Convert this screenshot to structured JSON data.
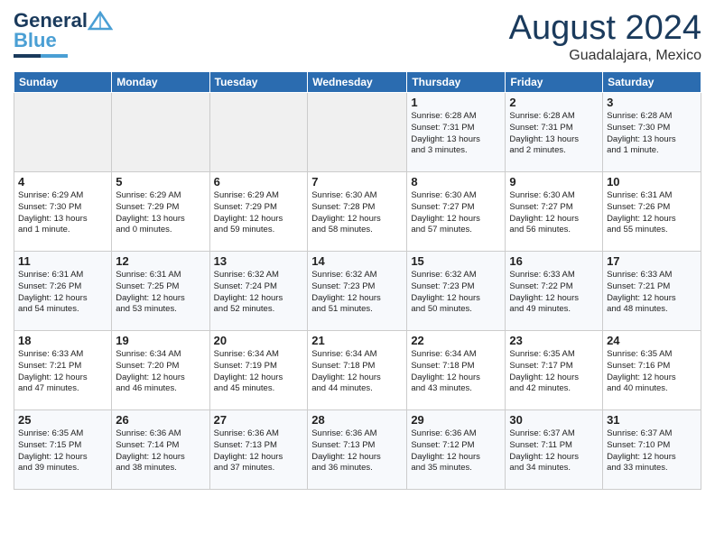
{
  "header": {
    "logo_line1": "General",
    "logo_line2": "Blue",
    "month": "August 2024",
    "location": "Guadalajara, Mexico"
  },
  "days_of_week": [
    "Sunday",
    "Monday",
    "Tuesday",
    "Wednesday",
    "Thursday",
    "Friday",
    "Saturday"
  ],
  "weeks": [
    [
      {
        "num": "",
        "info": ""
      },
      {
        "num": "",
        "info": ""
      },
      {
        "num": "",
        "info": ""
      },
      {
        "num": "",
        "info": ""
      },
      {
        "num": "1",
        "info": "Sunrise: 6:28 AM\nSunset: 7:31 PM\nDaylight: 13 hours\nand 3 minutes."
      },
      {
        "num": "2",
        "info": "Sunrise: 6:28 AM\nSunset: 7:31 PM\nDaylight: 13 hours\nand 2 minutes."
      },
      {
        "num": "3",
        "info": "Sunrise: 6:28 AM\nSunset: 7:30 PM\nDaylight: 13 hours\nand 1 minute."
      }
    ],
    [
      {
        "num": "4",
        "info": "Sunrise: 6:29 AM\nSunset: 7:30 PM\nDaylight: 13 hours\nand 1 minute."
      },
      {
        "num": "5",
        "info": "Sunrise: 6:29 AM\nSunset: 7:29 PM\nDaylight: 13 hours\nand 0 minutes."
      },
      {
        "num": "6",
        "info": "Sunrise: 6:29 AM\nSunset: 7:29 PM\nDaylight: 12 hours\nand 59 minutes."
      },
      {
        "num": "7",
        "info": "Sunrise: 6:30 AM\nSunset: 7:28 PM\nDaylight: 12 hours\nand 58 minutes."
      },
      {
        "num": "8",
        "info": "Sunrise: 6:30 AM\nSunset: 7:27 PM\nDaylight: 12 hours\nand 57 minutes."
      },
      {
        "num": "9",
        "info": "Sunrise: 6:30 AM\nSunset: 7:27 PM\nDaylight: 12 hours\nand 56 minutes."
      },
      {
        "num": "10",
        "info": "Sunrise: 6:31 AM\nSunset: 7:26 PM\nDaylight: 12 hours\nand 55 minutes."
      }
    ],
    [
      {
        "num": "11",
        "info": "Sunrise: 6:31 AM\nSunset: 7:26 PM\nDaylight: 12 hours\nand 54 minutes."
      },
      {
        "num": "12",
        "info": "Sunrise: 6:31 AM\nSunset: 7:25 PM\nDaylight: 12 hours\nand 53 minutes."
      },
      {
        "num": "13",
        "info": "Sunrise: 6:32 AM\nSunset: 7:24 PM\nDaylight: 12 hours\nand 52 minutes."
      },
      {
        "num": "14",
        "info": "Sunrise: 6:32 AM\nSunset: 7:23 PM\nDaylight: 12 hours\nand 51 minutes."
      },
      {
        "num": "15",
        "info": "Sunrise: 6:32 AM\nSunset: 7:23 PM\nDaylight: 12 hours\nand 50 minutes."
      },
      {
        "num": "16",
        "info": "Sunrise: 6:33 AM\nSunset: 7:22 PM\nDaylight: 12 hours\nand 49 minutes."
      },
      {
        "num": "17",
        "info": "Sunrise: 6:33 AM\nSunset: 7:21 PM\nDaylight: 12 hours\nand 48 minutes."
      }
    ],
    [
      {
        "num": "18",
        "info": "Sunrise: 6:33 AM\nSunset: 7:21 PM\nDaylight: 12 hours\nand 47 minutes."
      },
      {
        "num": "19",
        "info": "Sunrise: 6:34 AM\nSunset: 7:20 PM\nDaylight: 12 hours\nand 46 minutes."
      },
      {
        "num": "20",
        "info": "Sunrise: 6:34 AM\nSunset: 7:19 PM\nDaylight: 12 hours\nand 45 minutes."
      },
      {
        "num": "21",
        "info": "Sunrise: 6:34 AM\nSunset: 7:18 PM\nDaylight: 12 hours\nand 44 minutes."
      },
      {
        "num": "22",
        "info": "Sunrise: 6:34 AM\nSunset: 7:18 PM\nDaylight: 12 hours\nand 43 minutes."
      },
      {
        "num": "23",
        "info": "Sunrise: 6:35 AM\nSunset: 7:17 PM\nDaylight: 12 hours\nand 42 minutes."
      },
      {
        "num": "24",
        "info": "Sunrise: 6:35 AM\nSunset: 7:16 PM\nDaylight: 12 hours\nand 40 minutes."
      }
    ],
    [
      {
        "num": "25",
        "info": "Sunrise: 6:35 AM\nSunset: 7:15 PM\nDaylight: 12 hours\nand 39 minutes."
      },
      {
        "num": "26",
        "info": "Sunrise: 6:36 AM\nSunset: 7:14 PM\nDaylight: 12 hours\nand 38 minutes."
      },
      {
        "num": "27",
        "info": "Sunrise: 6:36 AM\nSunset: 7:13 PM\nDaylight: 12 hours\nand 37 minutes."
      },
      {
        "num": "28",
        "info": "Sunrise: 6:36 AM\nSunset: 7:13 PM\nDaylight: 12 hours\nand 36 minutes."
      },
      {
        "num": "29",
        "info": "Sunrise: 6:36 AM\nSunset: 7:12 PM\nDaylight: 12 hours\nand 35 minutes."
      },
      {
        "num": "30",
        "info": "Sunrise: 6:37 AM\nSunset: 7:11 PM\nDaylight: 12 hours\nand 34 minutes."
      },
      {
        "num": "31",
        "info": "Sunrise: 6:37 AM\nSunset: 7:10 PM\nDaylight: 12 hours\nand 33 minutes."
      }
    ]
  ]
}
